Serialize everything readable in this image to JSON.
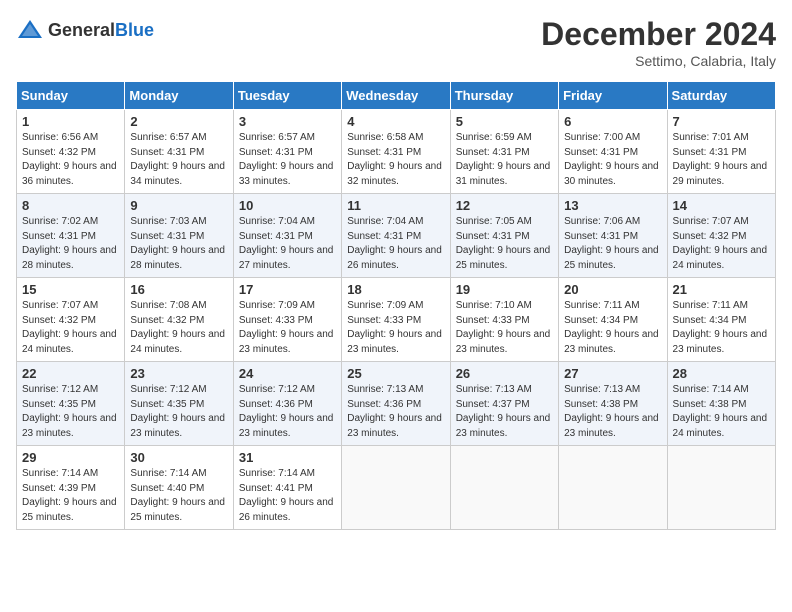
{
  "header": {
    "logo_general": "General",
    "logo_blue": "Blue",
    "month_title": "December 2024",
    "location": "Settimo, Calabria, Italy"
  },
  "weekdays": [
    "Sunday",
    "Monday",
    "Tuesday",
    "Wednesday",
    "Thursday",
    "Friday",
    "Saturday"
  ],
  "weeks": [
    [
      {
        "day": "1",
        "sunrise": "Sunrise: 6:56 AM",
        "sunset": "Sunset: 4:32 PM",
        "daylight": "Daylight: 9 hours and 36 minutes."
      },
      {
        "day": "2",
        "sunrise": "Sunrise: 6:57 AM",
        "sunset": "Sunset: 4:31 PM",
        "daylight": "Daylight: 9 hours and 34 minutes."
      },
      {
        "day": "3",
        "sunrise": "Sunrise: 6:57 AM",
        "sunset": "Sunset: 4:31 PM",
        "daylight": "Daylight: 9 hours and 33 minutes."
      },
      {
        "day": "4",
        "sunrise": "Sunrise: 6:58 AM",
        "sunset": "Sunset: 4:31 PM",
        "daylight": "Daylight: 9 hours and 32 minutes."
      },
      {
        "day": "5",
        "sunrise": "Sunrise: 6:59 AM",
        "sunset": "Sunset: 4:31 PM",
        "daylight": "Daylight: 9 hours and 31 minutes."
      },
      {
        "day": "6",
        "sunrise": "Sunrise: 7:00 AM",
        "sunset": "Sunset: 4:31 PM",
        "daylight": "Daylight: 9 hours and 30 minutes."
      },
      {
        "day": "7",
        "sunrise": "Sunrise: 7:01 AM",
        "sunset": "Sunset: 4:31 PM",
        "daylight": "Daylight: 9 hours and 29 minutes."
      }
    ],
    [
      {
        "day": "8",
        "sunrise": "Sunrise: 7:02 AM",
        "sunset": "Sunset: 4:31 PM",
        "daylight": "Daylight: 9 hours and 28 minutes."
      },
      {
        "day": "9",
        "sunrise": "Sunrise: 7:03 AM",
        "sunset": "Sunset: 4:31 PM",
        "daylight": "Daylight: 9 hours and 28 minutes."
      },
      {
        "day": "10",
        "sunrise": "Sunrise: 7:04 AM",
        "sunset": "Sunset: 4:31 PM",
        "daylight": "Daylight: 9 hours and 27 minutes."
      },
      {
        "day": "11",
        "sunrise": "Sunrise: 7:04 AM",
        "sunset": "Sunset: 4:31 PM",
        "daylight": "Daylight: 9 hours and 26 minutes."
      },
      {
        "day": "12",
        "sunrise": "Sunrise: 7:05 AM",
        "sunset": "Sunset: 4:31 PM",
        "daylight": "Daylight: 9 hours and 25 minutes."
      },
      {
        "day": "13",
        "sunrise": "Sunrise: 7:06 AM",
        "sunset": "Sunset: 4:31 PM",
        "daylight": "Daylight: 9 hours and 25 minutes."
      },
      {
        "day": "14",
        "sunrise": "Sunrise: 7:07 AM",
        "sunset": "Sunset: 4:32 PM",
        "daylight": "Daylight: 9 hours and 24 minutes."
      }
    ],
    [
      {
        "day": "15",
        "sunrise": "Sunrise: 7:07 AM",
        "sunset": "Sunset: 4:32 PM",
        "daylight": "Daylight: 9 hours and 24 minutes."
      },
      {
        "day": "16",
        "sunrise": "Sunrise: 7:08 AM",
        "sunset": "Sunset: 4:32 PM",
        "daylight": "Daylight: 9 hours and 24 minutes."
      },
      {
        "day": "17",
        "sunrise": "Sunrise: 7:09 AM",
        "sunset": "Sunset: 4:33 PM",
        "daylight": "Daylight: 9 hours and 23 minutes."
      },
      {
        "day": "18",
        "sunrise": "Sunrise: 7:09 AM",
        "sunset": "Sunset: 4:33 PM",
        "daylight": "Daylight: 9 hours and 23 minutes."
      },
      {
        "day": "19",
        "sunrise": "Sunrise: 7:10 AM",
        "sunset": "Sunset: 4:33 PM",
        "daylight": "Daylight: 9 hours and 23 minutes."
      },
      {
        "day": "20",
        "sunrise": "Sunrise: 7:11 AM",
        "sunset": "Sunset: 4:34 PM",
        "daylight": "Daylight: 9 hours and 23 minutes."
      },
      {
        "day": "21",
        "sunrise": "Sunrise: 7:11 AM",
        "sunset": "Sunset: 4:34 PM",
        "daylight": "Daylight: 9 hours and 23 minutes."
      }
    ],
    [
      {
        "day": "22",
        "sunrise": "Sunrise: 7:12 AM",
        "sunset": "Sunset: 4:35 PM",
        "daylight": "Daylight: 9 hours and 23 minutes."
      },
      {
        "day": "23",
        "sunrise": "Sunrise: 7:12 AM",
        "sunset": "Sunset: 4:35 PM",
        "daylight": "Daylight: 9 hours and 23 minutes."
      },
      {
        "day": "24",
        "sunrise": "Sunrise: 7:12 AM",
        "sunset": "Sunset: 4:36 PM",
        "daylight": "Daylight: 9 hours and 23 minutes."
      },
      {
        "day": "25",
        "sunrise": "Sunrise: 7:13 AM",
        "sunset": "Sunset: 4:36 PM",
        "daylight": "Daylight: 9 hours and 23 minutes."
      },
      {
        "day": "26",
        "sunrise": "Sunrise: 7:13 AM",
        "sunset": "Sunset: 4:37 PM",
        "daylight": "Daylight: 9 hours and 23 minutes."
      },
      {
        "day": "27",
        "sunrise": "Sunrise: 7:13 AM",
        "sunset": "Sunset: 4:38 PM",
        "daylight": "Daylight: 9 hours and 23 minutes."
      },
      {
        "day": "28",
        "sunrise": "Sunrise: 7:14 AM",
        "sunset": "Sunset: 4:38 PM",
        "daylight": "Daylight: 9 hours and 24 minutes."
      }
    ],
    [
      {
        "day": "29",
        "sunrise": "Sunrise: 7:14 AM",
        "sunset": "Sunset: 4:39 PM",
        "daylight": "Daylight: 9 hours and 25 minutes."
      },
      {
        "day": "30",
        "sunrise": "Sunrise: 7:14 AM",
        "sunset": "Sunset: 4:40 PM",
        "daylight": "Daylight: 9 hours and 25 minutes."
      },
      {
        "day": "31",
        "sunrise": "Sunrise: 7:14 AM",
        "sunset": "Sunset: 4:41 PM",
        "daylight": "Daylight: 9 hours and 26 minutes."
      },
      null,
      null,
      null,
      null
    ]
  ]
}
